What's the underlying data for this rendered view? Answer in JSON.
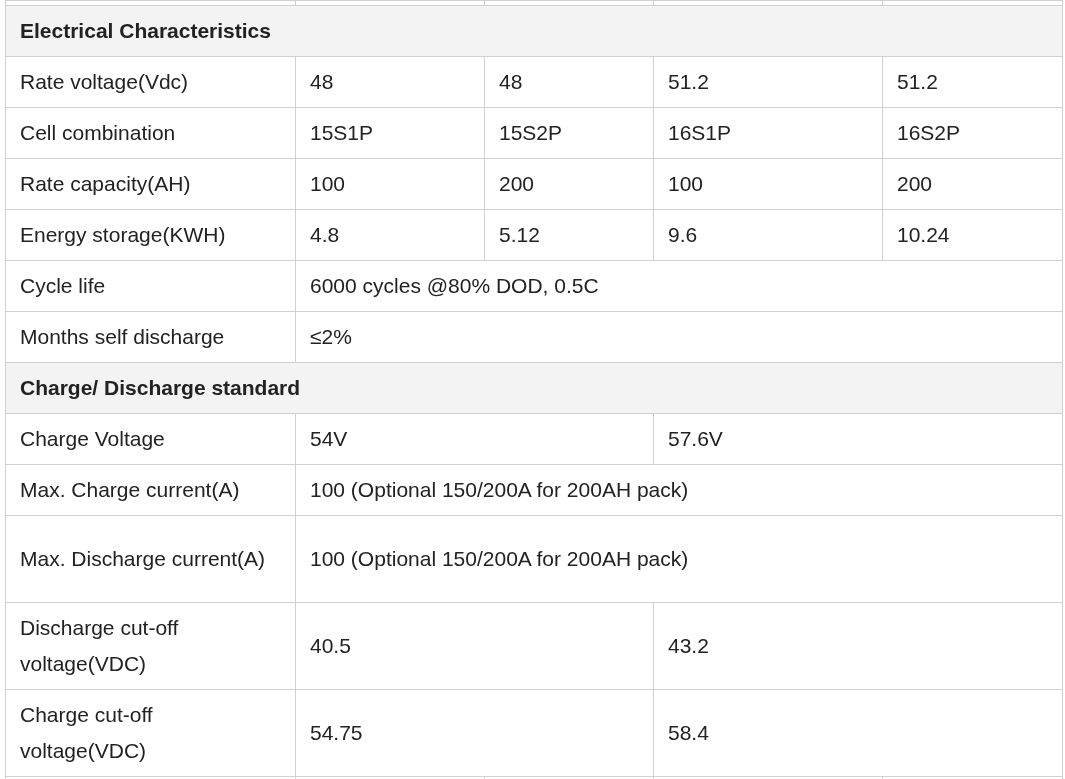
{
  "rows": [
    {
      "kind": "section",
      "label": "Electrical Characteristics"
    },
    {
      "kind": "data",
      "cells": [
        "Rate voltage(Vdc)",
        "48",
        "48",
        "51.2",
        "51.2"
      ]
    },
    {
      "kind": "data",
      "cells": [
        "Cell combination",
        "15S1P",
        "15S2P",
        "16S1P",
        "16S2P"
      ]
    },
    {
      "kind": "data",
      "cells": [
        "Rate capacity(AH)",
        "100",
        "200",
        "100",
        "200"
      ]
    },
    {
      "kind": "data",
      "cells": [
        "Energy storage(KWH)",
        "4.8",
        "5.12",
        "9.6",
        "10.24"
      ]
    },
    {
      "kind": "data",
      "cells": [
        "Cycle life",
        "6000 cycles @80% DOD, 0.5C"
      ]
    },
    {
      "kind": "data",
      "cells": [
        "Months self discharge",
        "≤2%"
      ]
    },
    {
      "kind": "section",
      "label": "Charge/ Discharge standard"
    },
    {
      "kind": "data",
      "cells": [
        "Charge Voltage",
        "54V",
        "57.6V"
      ]
    },
    {
      "kind": "data",
      "cells": [
        "Max. Charge current(A)",
        "100 (Optional 150/200A for 200AH pack)"
      ]
    },
    {
      "kind": "tall",
      "cells": [
        "Max. Discharge current(A)",
        "100 (Optional 150/200A for 200AH pack)"
      ]
    },
    {
      "kind": "tall",
      "cells": [
        "Discharge cut-off voltage(VDC)",
        "40.5",
        "43.2"
      ]
    },
    {
      "kind": "tall",
      "cells": [
        "Charge cut-off voltage(VDC)",
        "54.75",
        "58.4"
      ]
    }
  ]
}
